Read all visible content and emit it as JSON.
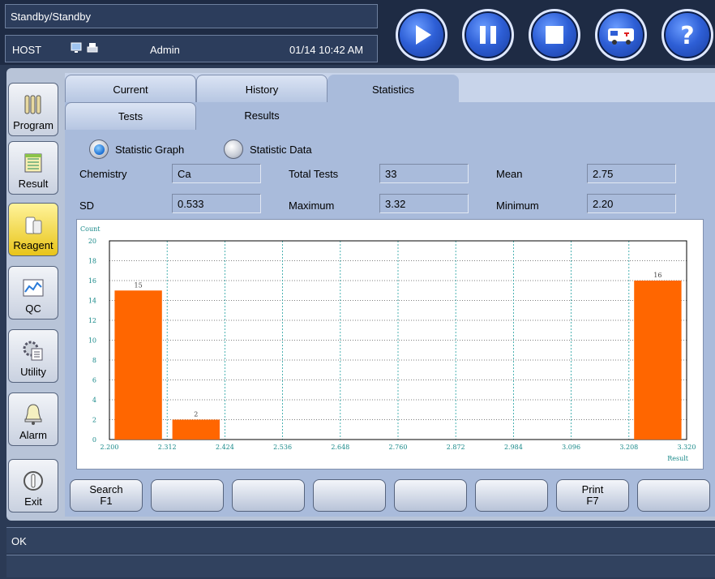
{
  "header": {
    "status": "Standby/Standby",
    "host": "HOST",
    "user": "Admin",
    "datetime": "01/14 10:42 AM",
    "icons": [
      "monitor-icon",
      "printer-icon"
    ],
    "control_buttons": [
      "play-icon",
      "pause-icon",
      "stop-icon",
      "ambulance-icon",
      "help-icon"
    ]
  },
  "nav": {
    "items": [
      {
        "label": "Program",
        "icon": "tubes-icon"
      },
      {
        "label": "Result",
        "icon": "notebook-icon"
      },
      {
        "label": "Reagent",
        "icon": "reagent-icon"
      },
      {
        "label": "QC",
        "icon": "qc-chart-icon"
      },
      {
        "label": "Utility",
        "icon": "utility-gear-icon"
      },
      {
        "label": "Alarm",
        "icon": "bell-icon"
      },
      {
        "label": "Exit",
        "icon": "power-icon"
      }
    ],
    "active": "Reagent"
  },
  "tabs": [
    "Current",
    "History",
    "Statistics"
  ],
  "active_tab": "Statistics",
  "subtabs": [
    "Tests",
    "Results"
  ],
  "active_subtab": "Results",
  "radios": [
    {
      "label": "Statistic Graph",
      "selected": true
    },
    {
      "label": "Statistic Data",
      "selected": false
    }
  ],
  "fields": {
    "chemistry_label": "Chemistry",
    "chemistry": "Ca",
    "total_tests_label": "Total Tests",
    "total_tests": "33",
    "mean_label": "Mean",
    "mean": "2.75",
    "sd_label": "SD",
    "sd": "0.533",
    "maximum_label": "Maximum",
    "maximum": "3.32",
    "minimum_label": "Minimum",
    "minimum": "2.20"
  },
  "fkeys": [
    {
      "line1": "Search",
      "line2": "F1"
    },
    {
      "line1": "",
      "line2": ""
    },
    {
      "line1": "",
      "line2": ""
    },
    {
      "line1": "",
      "line2": ""
    },
    {
      "line1": "",
      "line2": ""
    },
    {
      "line1": "",
      "line2": ""
    },
    {
      "line1": "Print",
      "line2": "F7"
    },
    {
      "line1": "",
      "line2": ""
    }
  ],
  "message": "OK",
  "colors": {
    "bar": "#ff6600",
    "grid": "#20a0a0",
    "axis_text": "#1a8a8a"
  },
  "chart_data": {
    "type": "bar",
    "xlabel": "Result",
    "ylabel": "Count",
    "x_ticks": [
      "2.200",
      "2.312",
      "2.424",
      "2.536",
      "2.648",
      "2.760",
      "2.872",
      "2.984",
      "3.096",
      "3.208",
      "3.320"
    ],
    "y_ticks": [
      "0",
      "2",
      "4",
      "6",
      "8",
      "10",
      "12",
      "14",
      "16",
      "18",
      "20"
    ],
    "ylim": [
      0,
      20
    ],
    "xlim": [
      2.2,
      3.32
    ],
    "grid": true,
    "bins": [
      {
        "from": 2.2,
        "to": 2.312,
        "value": 15
      },
      {
        "from": 2.312,
        "to": 2.424,
        "value": 2
      },
      {
        "from": 3.208,
        "to": 3.32,
        "value": 16
      }
    ]
  }
}
